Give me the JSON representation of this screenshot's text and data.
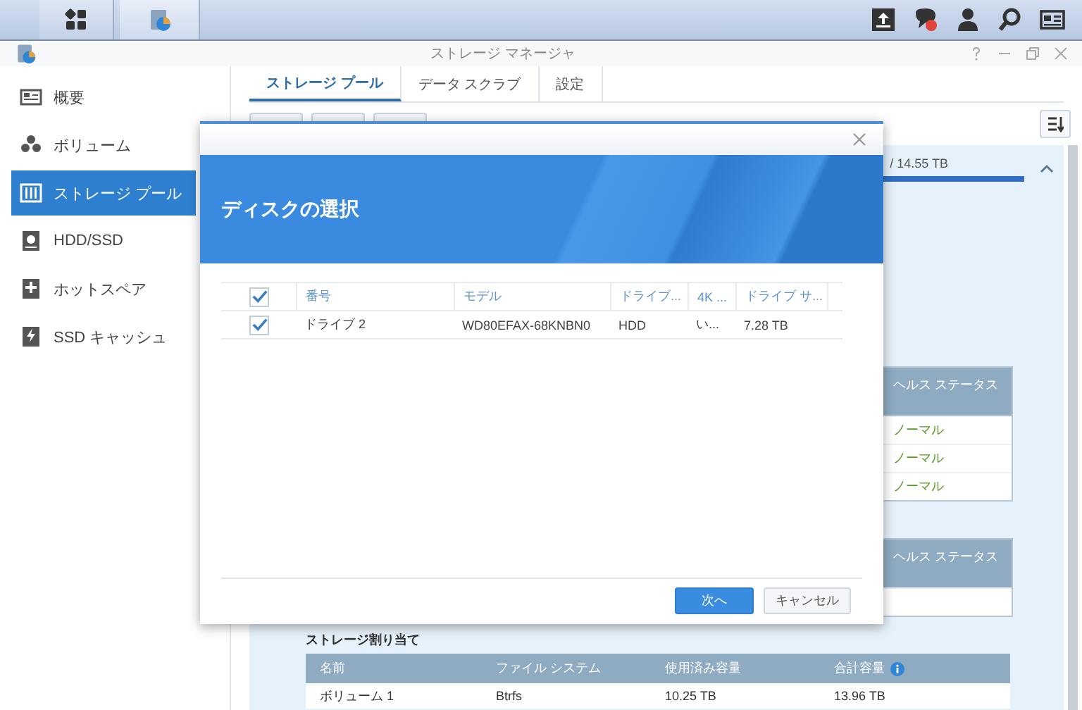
{
  "window": {
    "title": "ストレージ マネージャ"
  },
  "sidebar": {
    "items": [
      {
        "label": "概要",
        "selected": false
      },
      {
        "label": "ボリューム",
        "selected": false
      },
      {
        "label": "ストレージ プール",
        "selected": true
      },
      {
        "label": "HDD/SSD",
        "selected": false
      },
      {
        "label": "ホットスペア",
        "selected": false
      },
      {
        "label": "SSD キャッシュ",
        "selected": false
      }
    ]
  },
  "tabs": [
    {
      "label": "ストレージ プール",
      "selected": true
    },
    {
      "label": "データ スクラブ",
      "selected": false
    },
    {
      "label": "設定",
      "selected": false
    }
  ],
  "usage": {
    "text": "/ 14.55 TB",
    "level": 1
  },
  "health_tables": [
    {
      "header": "ヘルス ステータス",
      "rows": [
        "ノーマル",
        "ノーマル",
        "ノーマル"
      ]
    },
    {
      "header": "ヘルス ステータス"
    }
  ],
  "allocation": {
    "title": "ストレージ割り当て",
    "columns": [
      "名前",
      "ファイル システム",
      "使用済み容量",
      "合計容量"
    ],
    "rows": [
      [
        "ボリューム 1",
        "Btrfs",
        "10.25 TB",
        "13.96 TB"
      ]
    ]
  },
  "dialog": {
    "title": "ディスクの選択",
    "select_all_checked": true,
    "columns": [
      "番号",
      "モデル",
      "ドライブ...",
      "4K ...",
      "ドライブ サ..."
    ],
    "rows": [
      {
        "checked": true,
        "cells": [
          "ドライブ 2",
          "WD80EFAX-68KNBN0",
          "HDD",
          "い...",
          "7.28 TB"
        ]
      }
    ],
    "buttons": [
      {
        "label": "次へ",
        "kind": "primary"
      },
      {
        "label": "キャンセル",
        "kind": "secondary"
      }
    ]
  }
}
